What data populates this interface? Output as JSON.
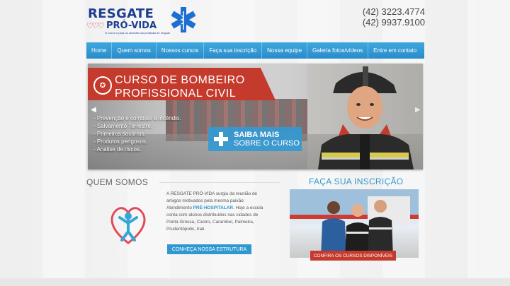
{
  "header": {
    "logo_title": "RESGATE",
    "logo_subtitle": "PRÓ-VIDA",
    "logo_tagline": "O Curso é para os amantes da profissão de resgate",
    "phone1": "(42) 3223.4774",
    "phone2": "(42) 9937.9100"
  },
  "nav": {
    "items": [
      {
        "label": "Home"
      },
      {
        "label": "Quem somos"
      },
      {
        "label": "Nossos cursos"
      },
      {
        "label": "Faça sua inscrição"
      },
      {
        "label": "Nossa equipe"
      },
      {
        "label": "Galeria fotos/vídeos"
      },
      {
        "label": "Entre em contato"
      }
    ]
  },
  "banner": {
    "title_line1": "CURSO DE BOMBEIRO",
    "title_line2": "PROFISSIONAL CIVIL",
    "bullets": [
      "- Prevenção e combate a incêndio.",
      "- Salvamento Terrestre.",
      "- Primeiros socorros.",
      "- Produtos perigosos.",
      "- Análise de riscos."
    ],
    "cta_line1": "SAIBA MAIS",
    "cta_line2": "SOBRE O CURSO",
    "arrow_left": "◀",
    "arrow_right": "▶"
  },
  "quem_somos": {
    "title": "QUEM SOMOS",
    "text_before": "A RESGATE PRÓ-VIDA surgiu da reunião de amigos motivados pela mesma paixão: Atendimento ",
    "highlight": "PRÉ-HOSPITALAR",
    "text_after": ". Hoje a escola conta com alunos distribuídos nas cidades de Ponta Grossa, Castro, Carambeí, Palmeira, Prudentópolis, Irati.",
    "button": "CONHEÇA NOSSA ESTRUTURA"
  },
  "inscricao": {
    "title": "FAÇA SUA INSCRIÇÃO",
    "button": "CONFIRA OS CURSOS DISPONÍVEIS"
  },
  "colors": {
    "brand_blue": "#1d3f8f",
    "accent_blue": "#2f98d0",
    "accent_red": "#c43a2c"
  },
  "icons": [
    "star-of-life-icon",
    "hearts-icon",
    "medal-icon",
    "medical-cross-icon",
    "heart-person-icon"
  ]
}
